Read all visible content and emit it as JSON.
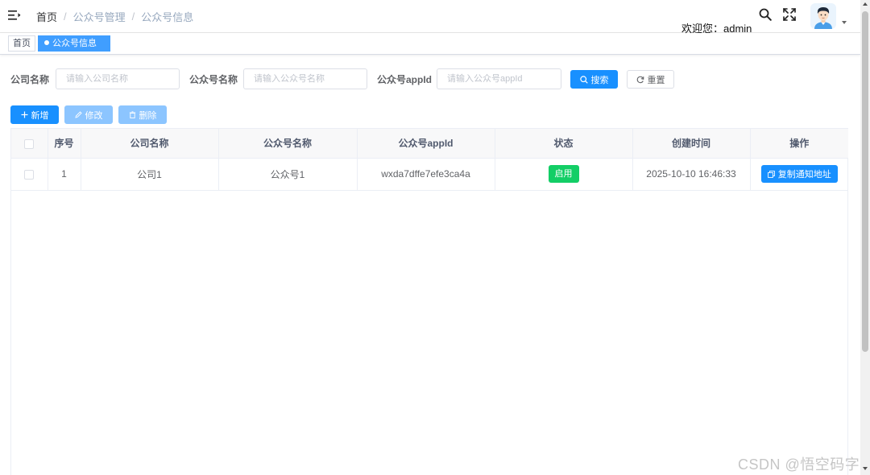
{
  "navbar": {
    "breadcrumb": [
      "首页",
      "公众号管理",
      "公众号信息"
    ],
    "separator": "/",
    "welcome": "欢迎您：admin"
  },
  "tags": {
    "home": "首页",
    "active": "公众号信息",
    "close": "×"
  },
  "search_form": {
    "company_label": "公司名称",
    "company_placeholder": "请输入公司名称",
    "account_label": "公众号名称",
    "account_placeholder": "请输入公众号名称",
    "appid_label": "公众号appId",
    "appid_placeholder": "请输入公众号appId",
    "search_button": "搜索",
    "reset_button": "重置"
  },
  "toolbar": {
    "add": "新增",
    "edit": "修改",
    "delete": "删除"
  },
  "table": {
    "headers": [
      "序号",
      "公司名称",
      "公众号名称",
      "公众号appId",
      "状态",
      "创建时间",
      "操作"
    ],
    "rows": [
      {
        "index": "1",
        "company": "公司1",
        "account": "公众号1",
        "appid": "wxda7dffe7efe3ca4a",
        "status": "启用",
        "created": "2025-10-10 16:46:33",
        "action": "复制通知地址"
      }
    ]
  },
  "colors": {
    "primary": "#1890ff",
    "primary_light": "#8cc5ff",
    "success": "#13ce66",
    "tag_active": "#409eff"
  },
  "icons": [
    "hamburger-icon",
    "search-icon",
    "fullscreen-icon",
    "avatar",
    "caret-down-icon",
    "plus-icon",
    "edit-icon",
    "trash-icon",
    "refresh-icon",
    "copy-icon"
  ],
  "watermark": "CSDN @悟空码字"
}
